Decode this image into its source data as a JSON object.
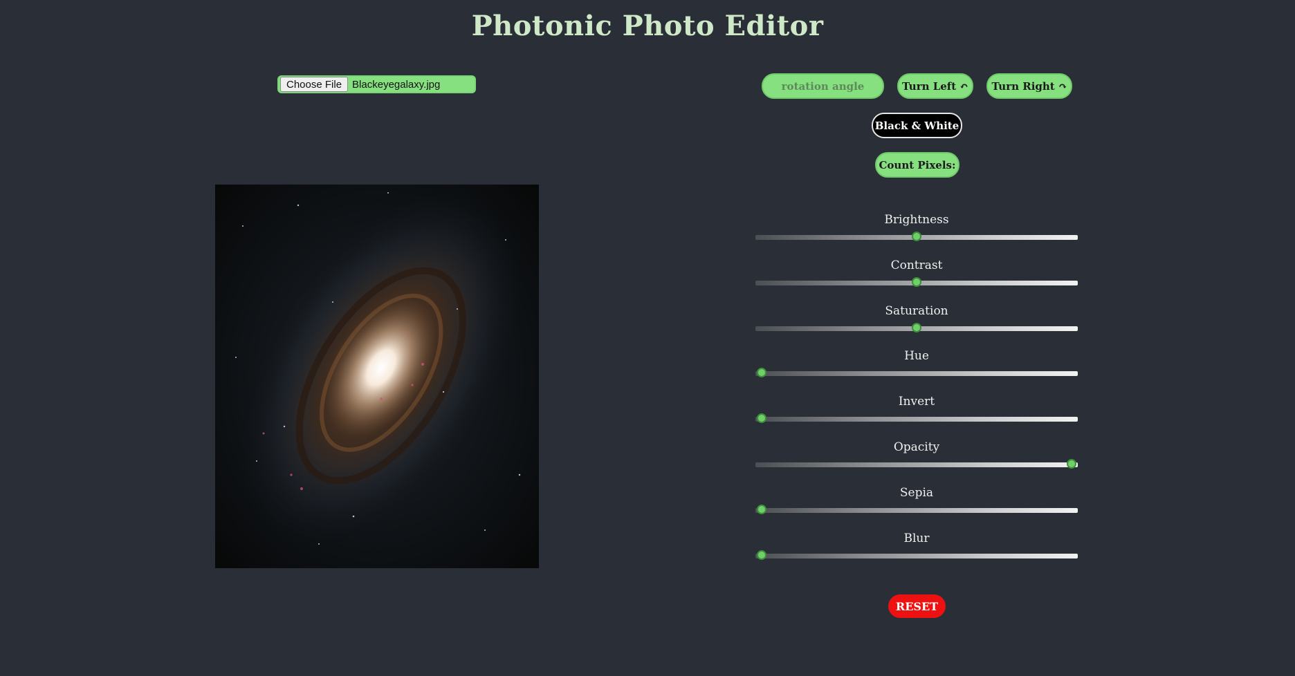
{
  "app": {
    "title": "Photonic Photo Editor"
  },
  "file_input": {
    "button_label": "Choose File",
    "file_name": "Blackeyegalaxy.jpg"
  },
  "rotation": {
    "placeholder": "rotation angle",
    "turn_left_label": "Turn Left ↶",
    "turn_right_label": "Turn Right ↷"
  },
  "buttons": {
    "black_white_label": "Black & White",
    "count_pixels_label": "Count Pixels:",
    "reset_label": "RESET"
  },
  "sliders": [
    {
      "label": "Brightness",
      "value": 0.5
    },
    {
      "label": "Contrast",
      "value": 0.5
    },
    {
      "label": "Saturation",
      "value": 0.5
    },
    {
      "label": "Hue",
      "value": 0.0
    },
    {
      "label": "Invert",
      "value": 0.0
    },
    {
      "label": "Opacity",
      "value": 1.0
    },
    {
      "label": "Sepia",
      "value": 0.0
    },
    {
      "label": "Blur",
      "value": 0.0
    }
  ],
  "colors": {
    "background": "#2a2f37",
    "accent_green": "#86e080",
    "reset_red": "#ee1111",
    "title_color": "#cfe9c8"
  }
}
